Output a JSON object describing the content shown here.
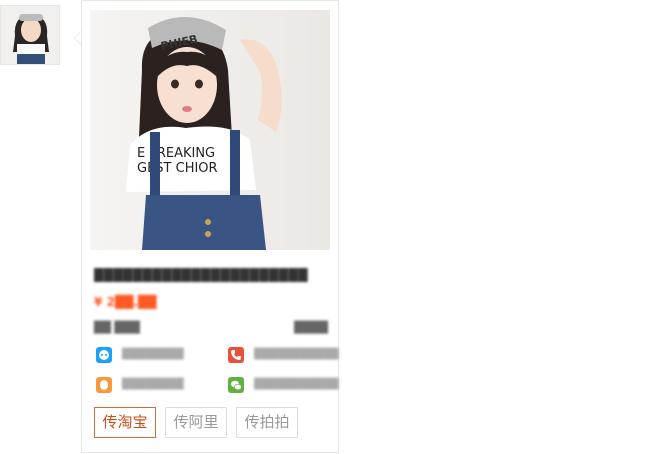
{
  "thumbnail": {
    "alt": "product thumbnail"
  },
  "product": {
    "shirt_text_line1": "E FREAKING",
    "shirt_text_line2": "GEST CHIOR",
    "cap_text": "PHIEB",
    "title": "██████████████████████",
    "price": "¥ 2██.██",
    "location": "██ ███",
    "shop": "████"
  },
  "contacts": [
    {
      "icon": "chat-icon",
      "color": "#1da1f2",
      "text": "████████"
    },
    {
      "icon": "phone-icon",
      "color": "#e8503a",
      "text": "███████████"
    },
    {
      "icon": "qq-icon",
      "color": "#f79a3e",
      "text": "████████"
    },
    {
      "icon": "wechat-icon",
      "color": "#61b13f",
      "text": "███████████"
    }
  ],
  "actions": {
    "taobao": "传淘宝",
    "alibaba": "传阿里",
    "paipai": "传拍拍"
  },
  "colors": {
    "accent": "#c94e1a",
    "price": "#ff5a24"
  }
}
